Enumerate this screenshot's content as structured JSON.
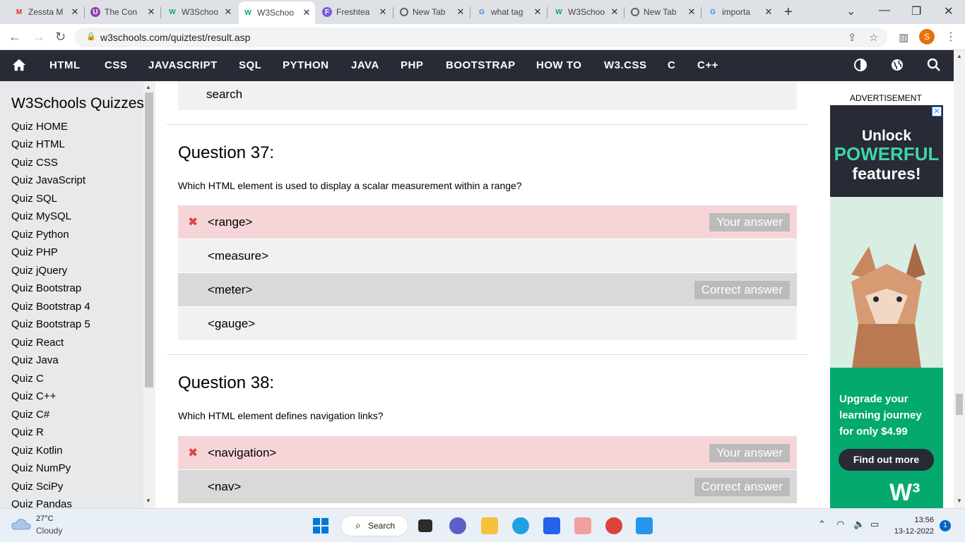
{
  "browser": {
    "tabs": [
      {
        "title": "Zessta M",
        "favicon": "gmail-icon",
        "color": "#d93025"
      },
      {
        "title": "The Con",
        "favicon": "purple-u-icon",
        "color": "#8e44ad"
      },
      {
        "title": "W3Schoo",
        "favicon": "w3-icon",
        "color": "#04aa6d"
      },
      {
        "title": "W3Schoo",
        "favicon": "w3-icon",
        "color": "#04aa6d"
      },
      {
        "title": "Freshtea",
        "favicon": "freshteam-icon",
        "color": "#7b5cd6"
      },
      {
        "title": "New Tab",
        "favicon": "chrome-icon",
        "color": "#5f6368"
      },
      {
        "title": "what tag",
        "favicon": "google-icon",
        "color": "#4285f4"
      },
      {
        "title": "W3Schoo",
        "favicon": "w3-icon",
        "color": "#04aa6d"
      },
      {
        "title": "New Tab",
        "favicon": "chrome-icon",
        "color": "#5f6368"
      },
      {
        "title": "importa",
        "favicon": "google-icon",
        "color": "#4285f4"
      }
    ],
    "active_tab": 3,
    "url": "w3schools.com/quiztest/result.asp",
    "profile_initial": "S"
  },
  "topnav": {
    "links": [
      "HTML",
      "CSS",
      "JAVASCRIPT",
      "SQL",
      "PYTHON",
      "JAVA",
      "PHP",
      "BOOTSTRAP",
      "HOW TO",
      "W3.CSS",
      "C",
      "C++"
    ]
  },
  "sidebar": {
    "title": "W3Schools Quizzes",
    "items": [
      "Quiz HOME",
      "Quiz HTML",
      "Quiz CSS",
      "Quiz JavaScript",
      "Quiz SQL",
      "Quiz MySQL",
      "Quiz Python",
      "Quiz PHP",
      "Quiz jQuery",
      "Quiz Bootstrap",
      "Quiz Bootstrap 4",
      "Quiz Bootstrap 5",
      "Quiz React",
      "Quiz Java",
      "Quiz C",
      "Quiz C++",
      "Quiz C#",
      "Quiz R",
      "Quiz Kotlin",
      "Quiz NumPy",
      "Quiz SciPy",
      "Quiz Pandas"
    ]
  },
  "main": {
    "prev_answer": "search",
    "q37": {
      "title": "Question 37:",
      "text": "Which HTML element is used to display a scalar measurement within a range?",
      "answers": [
        "<range>",
        "<measure>",
        "<meter>",
        "<gauge>"
      ]
    },
    "q38": {
      "title": "Question 38:",
      "text": "Which HTML element defines navigation links?",
      "answers": [
        "<navigation>",
        "<nav>"
      ]
    },
    "your_answer": "Your answer",
    "correct_answer": "Correct answer",
    "wrong_mark": "✖"
  },
  "ad": {
    "label": "ADVERTISEMENT",
    "close": "✕",
    "line1": "Unlock",
    "line2": "POWERFUL",
    "line3": "features!",
    "upgrade": "Upgrade your learning journey for only $4.99",
    "button": "Find out more",
    "logo": "W³"
  },
  "taskbar": {
    "temp": "27°C",
    "weather": "Cloudy",
    "search": "Search",
    "time": "13:56",
    "date": "13-12-2022",
    "notifications": "1"
  }
}
